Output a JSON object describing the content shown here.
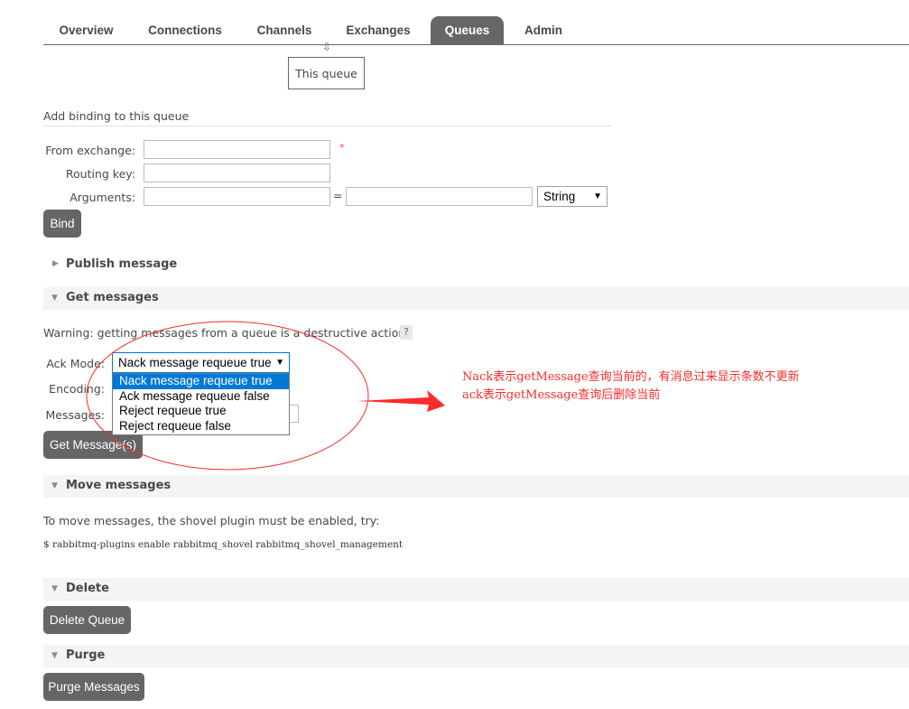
{
  "tabs": [
    {
      "label": "Overview",
      "active": false
    },
    {
      "label": "Connections",
      "active": false
    },
    {
      "label": "Channels",
      "active": false
    },
    {
      "label": "Exchanges",
      "active": false
    },
    {
      "label": "Queues",
      "active": true
    },
    {
      "label": "Admin",
      "active": false
    }
  ],
  "bindings_graph": {
    "this_queue": "This queue"
  },
  "add_binding": {
    "title": "Add binding to this queue",
    "from_exchange_label": "From exchange:",
    "required_mark": "*",
    "routing_key_label": "Routing key:",
    "arguments_label": "Arguments:",
    "equals": "=",
    "type_value": "String",
    "bind_button": "Bind"
  },
  "sections": {
    "publish": "Publish message",
    "get": "Get messages",
    "move": "Move messages",
    "delete": "Delete",
    "purge": "Purge"
  },
  "get_messages": {
    "warning": "Warning: getting messages from a queue is a destructive action.",
    "help": "?",
    "ack_mode_label": "Ack Mode:",
    "ack_mode_value": "Nack message requeue true",
    "ack_options": [
      "Nack message requeue true",
      "Ack message requeue false",
      "Reject requeue true",
      "Reject requeue false"
    ],
    "encoding_label": "Encoding:",
    "messages_label": "Messages:",
    "get_button": "Get Message(s)"
  },
  "move_messages": {
    "info": "To move messages, the shovel plugin must be enabled, try:",
    "command": "$ rabbitmq-plugins enable rabbitmq_shovel rabbitmq_shovel_management"
  },
  "delete": {
    "button": "Delete Queue"
  },
  "purge": {
    "button": "Purge Messages"
  },
  "annotation": {
    "line1": "Nack表示getMessage查询当前的，有消息过来显示条数不更新",
    "line2": "ack表示getMessage查询后删除当前"
  },
  "colors": {
    "tab_active": "#666666",
    "annotation": "#ff2a2a",
    "selection": "#0078d7"
  }
}
